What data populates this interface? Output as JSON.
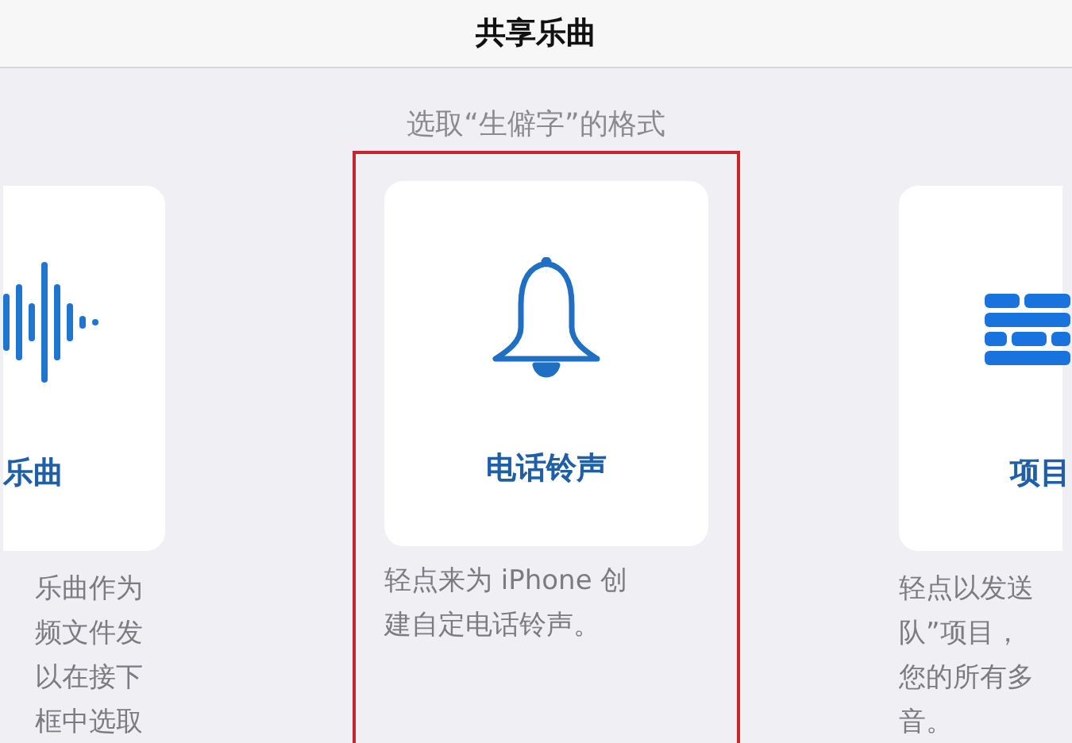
{
  "header": {
    "title": "共享乐曲"
  },
  "subtitle": "选取“生僻字”的格式",
  "cards": [
    {
      "kind": "waveform",
      "label": "乐曲",
      "highlighted": false,
      "description_lines": [
        "乐曲作为",
        "频文件发",
        "以在接下",
        "框中选取"
      ]
    },
    {
      "kind": "bell",
      "label": "电话铃声",
      "highlighted": true,
      "description_lines": [
        "轻点来为 iPhone 创",
        "建自定电话铃声。"
      ]
    },
    {
      "kind": "bricks",
      "label": "项目",
      "highlighted": false,
      "description_lines": [
        "轻点以发送",
        "队”项目，",
        "您的所有多",
        "音。"
      ]
    }
  ]
}
